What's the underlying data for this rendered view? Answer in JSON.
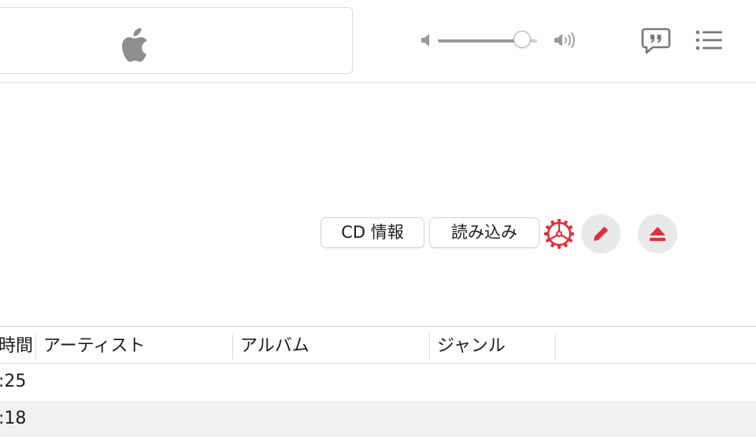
{
  "toolbar": {
    "logo_icon": "apple-logo-icon",
    "volume": {
      "level": 0.85,
      "low_icon": "speaker-low-icon",
      "high_icon": "speaker-high-icon"
    },
    "lyrics_icon": "lyrics-quote-bubble-icon",
    "queue_icon": "up-next-list-icon"
  },
  "cd_actions": {
    "cd_info_label": "CD 情報",
    "import_label": "読み込み",
    "options_icon": "gear-icon",
    "edit_icon": "pencil-icon",
    "eject_icon": "eject-icon",
    "accent_color": "#e0303a"
  },
  "table": {
    "columns": [
      {
        "key": "time",
        "label": "時間"
      },
      {
        "key": "artist",
        "label": "アーティスト"
      },
      {
        "key": "album",
        "label": "アルバム"
      },
      {
        "key": "genre",
        "label": "ジャンル"
      }
    ],
    "rows": [
      {
        "time": ":25",
        "artist": "",
        "album": "",
        "genre": ""
      },
      {
        "time": ":18",
        "artist": "",
        "album": "",
        "genre": ""
      }
    ]
  },
  "colors": {
    "icon_gray": "#8e8e8e",
    "row_alt": "#f1f1f1",
    "divider": "#e3e3e3"
  }
}
